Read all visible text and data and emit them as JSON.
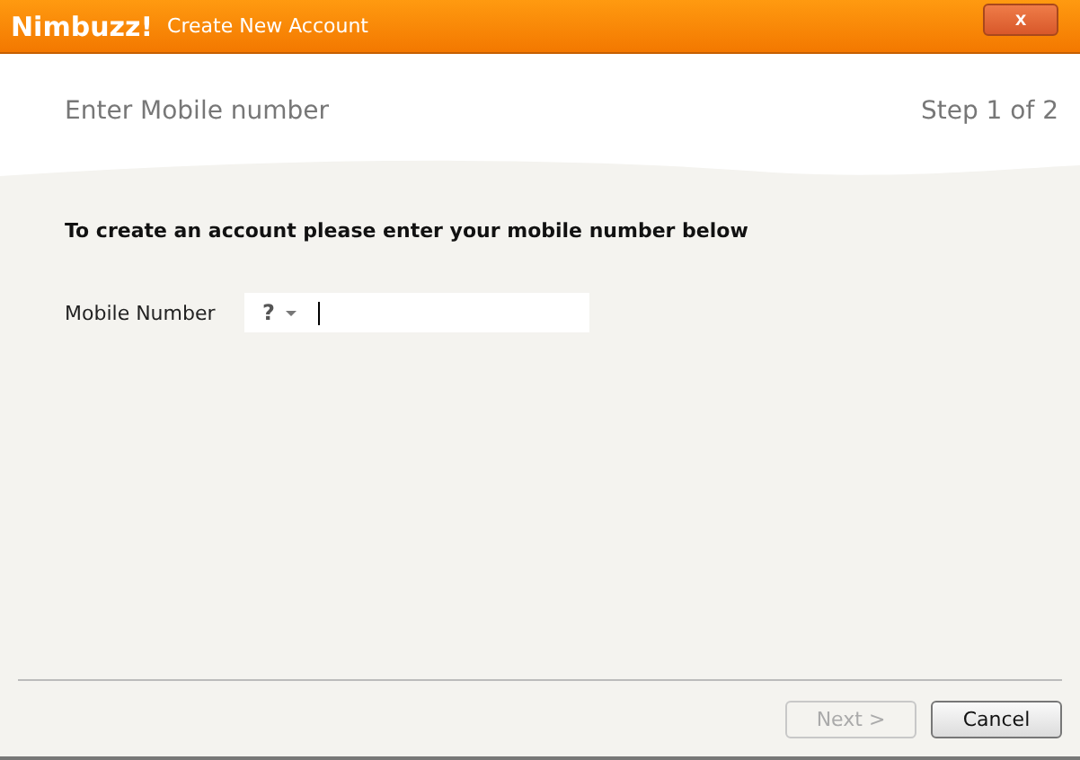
{
  "window": {
    "logo": "Nimbuzz!",
    "title": "Create New Account",
    "close": "x"
  },
  "header": {
    "title": "Enter Mobile number",
    "step": "Step 1 of 2"
  },
  "instruction": "To create an account please enter your mobile number below",
  "mobile_field": {
    "label": "Mobile Number",
    "country_code": "?",
    "focused": true
  },
  "buttons": [
    {
      "label": "Next >",
      "disabled": true
    },
    {
      "label": "Cancel",
      "disabled": false
    }
  ]
}
